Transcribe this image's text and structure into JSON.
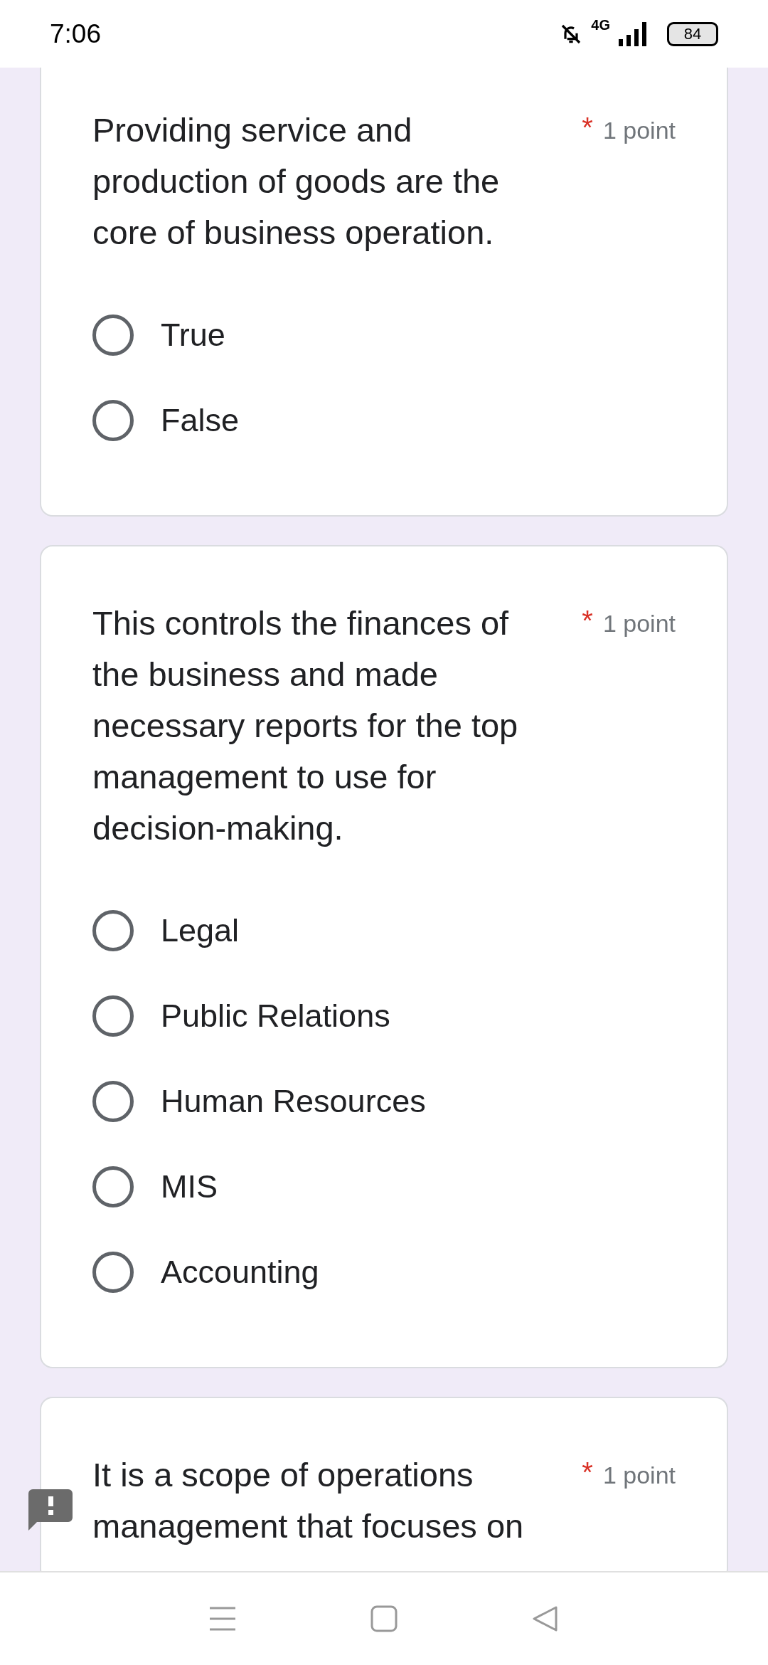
{
  "status_bar": {
    "time": "7:06",
    "network": "4G",
    "battery": "84"
  },
  "questions": [
    {
      "text": "Providing service and production of goods are the core of business operation.",
      "required_mark": "*",
      "points": "1 point",
      "options": [
        {
          "label": "True",
          "selected": false
        },
        {
          "label": "False",
          "selected": false
        }
      ]
    },
    {
      "text": "This controls the finances of the business and made necessary reports for the top management to use for decision-making.",
      "required_mark": "*",
      "points": "1 point",
      "options": [
        {
          "label": "Legal",
          "selected": false
        },
        {
          "label": "Public Relations",
          "selected": false
        },
        {
          "label": "Human Resources",
          "selected": false
        },
        {
          "label": "MIS",
          "selected": false
        },
        {
          "label": "Accounting",
          "selected": false
        }
      ]
    },
    {
      "text": "It is a scope of operations management that focuses on",
      "required_mark": "*",
      "points": "1 point"
    }
  ]
}
